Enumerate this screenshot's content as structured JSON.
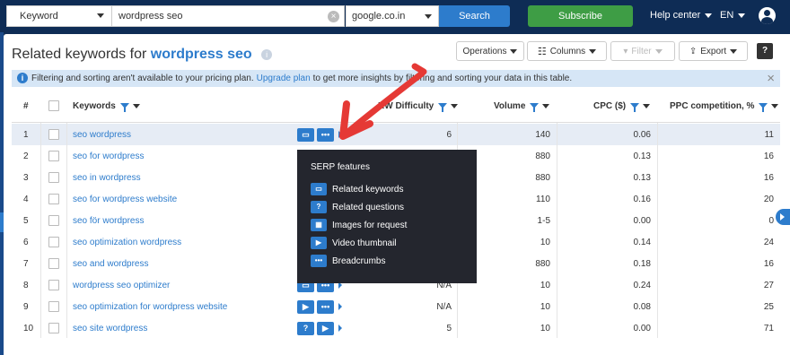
{
  "topbar": {
    "database_label": "Keyword",
    "search_value": "wordpress seo",
    "domain_value": "google.co.in",
    "search_button": "Search",
    "subscribe_button": "Subscribe",
    "help_label": "Help center",
    "lang_label": "EN"
  },
  "panel": {
    "title_prefix": "Related keywords for",
    "title_query": "wordpress seo",
    "info_icon": "i",
    "buttons": {
      "operations": "Operations",
      "columns": "Columns",
      "filter": "Filter",
      "export": "Export",
      "help": "?"
    },
    "notice": {
      "text_before": "Filtering and sorting aren't available to your pricing plan.",
      "link": "Upgrade plan",
      "text_after": "to get more insights by filtering and sorting your data in this table.",
      "close": "×"
    }
  },
  "table": {
    "headers": {
      "index": "#",
      "keywords": "Keywords",
      "difficulty": "KW Difficulty",
      "volume": "Volume",
      "cpc": "CPC ($)",
      "ppc": "PPC competition, %"
    },
    "rows": [
      {
        "n": "1",
        "kw": "seo wordpress",
        "diff": "6",
        "vol": "140",
        "cpc": "0.06",
        "ppc": "11",
        "serp": [
          "related",
          "breadcrumbs"
        ]
      },
      {
        "n": "2",
        "kw": "seo for wordpress",
        "diff": "",
        "vol": "880",
        "cpc": "0.13",
        "ppc": "16",
        "serp": []
      },
      {
        "n": "3",
        "kw": "seo in wordpress",
        "diff": "",
        "vol": "880",
        "cpc": "0.13",
        "ppc": "16",
        "serp": []
      },
      {
        "n": "4",
        "kw": "seo for wordpress website",
        "diff": "",
        "vol": "110",
        "cpc": "0.16",
        "ppc": "20",
        "serp": []
      },
      {
        "n": "5",
        "kw": "seo för wordpress",
        "diff": "",
        "vol": "1-5",
        "cpc": "0.00",
        "ppc": "0",
        "serp": []
      },
      {
        "n": "6",
        "kw": "seo optimization wordpress",
        "diff": "",
        "vol": "10",
        "cpc": "0.14",
        "ppc": "24",
        "serp": []
      },
      {
        "n": "7",
        "kw": "seo and wordpress",
        "diff": "",
        "vol": "880",
        "cpc": "0.18",
        "ppc": "16",
        "serp": []
      },
      {
        "n": "8",
        "kw": "wordpress seo optimizer",
        "diff": "N/A",
        "vol": "10",
        "cpc": "0.24",
        "ppc": "27",
        "serp": [
          "related",
          "breadcrumbs"
        ]
      },
      {
        "n": "9",
        "kw": "seo optimization for wordpress website",
        "diff": "N/A",
        "vol": "10",
        "cpc": "0.08",
        "ppc": "25",
        "serp": [
          "video",
          "breadcrumbs"
        ]
      },
      {
        "n": "10",
        "kw": "seo site wordpress",
        "diff": "5",
        "vol": "10",
        "cpc": "0.00",
        "ppc": "71",
        "serp": [
          "questions",
          "video"
        ]
      }
    ]
  },
  "popup": {
    "title": "SERP features",
    "items": [
      {
        "label": "Related keywords",
        "icon": "chat-icon"
      },
      {
        "label": "Related questions",
        "icon": "question-icon"
      },
      {
        "label": "Images for request",
        "icon": "image-icon"
      },
      {
        "label": "Video thumbnail",
        "icon": "video-icon"
      },
      {
        "label": "Breadcrumbs",
        "icon": "dots-icon"
      }
    ]
  },
  "colors": {
    "navy": "#0e2c55",
    "blue": "#2d7ccc",
    "green": "#3e9d45",
    "annotation_red": "#e53935"
  }
}
